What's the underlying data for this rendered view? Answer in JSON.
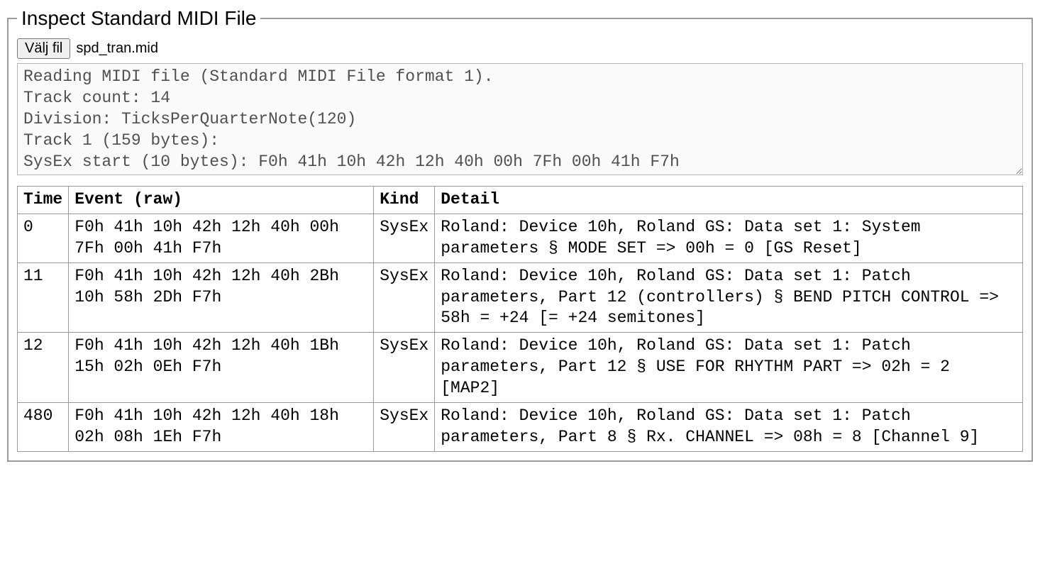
{
  "legend": "Inspect Standard MIDI File",
  "file_button": "Välj fil",
  "file_name": "spd_tran.mid",
  "log": "Reading MIDI file (Standard MIDI File format 1).\nTrack count: 14\nDivision: TicksPerQuarterNote(120)\nTrack 1 (159 bytes):\nSysEx start (10 bytes): F0h 41h 10h 42h 12h 40h 00h 7Fh 00h 41h F7h",
  "headers": {
    "time": "Time",
    "event": "Event (raw)",
    "kind": "Kind",
    "detail": "Detail"
  },
  "rows": [
    {
      "time": "0",
      "event": "F0h 41h 10h 42h 12h 40h 00h 7Fh 00h 41h F7h",
      "kind": "SysEx",
      "detail": "Roland: Device 10h, Roland GS: Data set 1: System parameters § MODE SET => 00h = 0 [GS Reset]"
    },
    {
      "time": "11",
      "event": "F0h 41h 10h 42h 12h 40h 2Bh 10h 58h 2Dh F7h",
      "kind": "SysEx",
      "detail": "Roland: Device 10h, Roland GS: Data set 1: Patch parameters, Part 12 (controllers) § BEND PITCH CONTROL => 58h = +24 [= +24 semitones]"
    },
    {
      "time": "12",
      "event": "F0h 41h 10h 42h 12h 40h 1Bh 15h 02h 0Eh F7h",
      "kind": "SysEx",
      "detail": "Roland: Device 10h, Roland GS: Data set 1: Patch parameters, Part 12 § USE FOR RHYTHM PART => 02h = 2 [MAP2]"
    },
    {
      "time": "480",
      "event": "F0h 41h 10h 42h 12h 40h 18h 02h 08h 1Eh F7h",
      "kind": "SysEx",
      "detail": "Roland: Device 10h, Roland GS: Data set 1: Patch parameters, Part 8 § Rx. CHANNEL => 08h = 8 [Channel 9]"
    }
  ]
}
